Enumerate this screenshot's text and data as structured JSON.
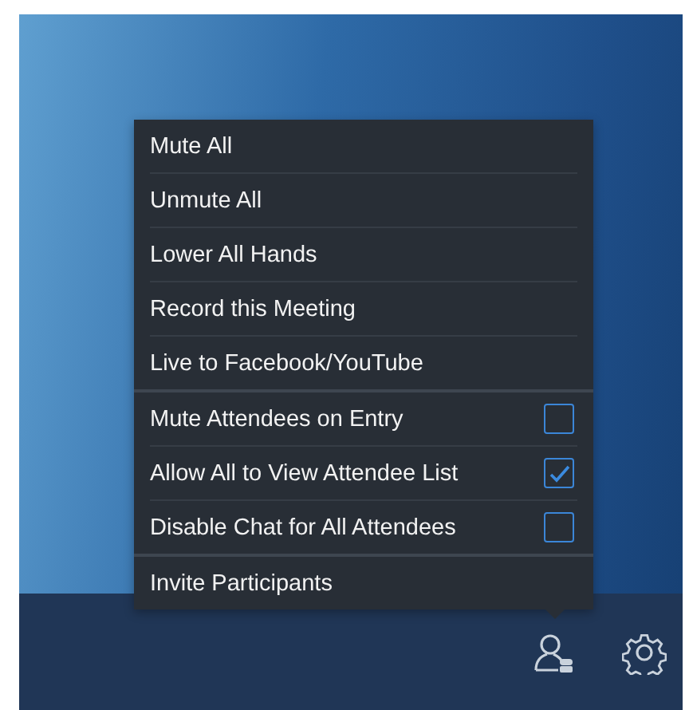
{
  "menu": {
    "groups": [
      {
        "items": [
          {
            "kind": "action",
            "label": "Mute All"
          },
          {
            "kind": "action",
            "label": "Unmute All"
          },
          {
            "kind": "action",
            "label": "Lower All Hands"
          },
          {
            "kind": "action",
            "label": "Record this Meeting"
          },
          {
            "kind": "action",
            "label": "Live to Facebook/YouTube"
          }
        ]
      },
      {
        "items": [
          {
            "kind": "toggle",
            "label": "Mute Attendees on Entry",
            "checked": false
          },
          {
            "kind": "toggle",
            "label": "Allow All to View Attendee List",
            "checked": true
          },
          {
            "kind": "toggle",
            "label": "Disable Chat for All Attendees",
            "checked": false
          }
        ]
      },
      {
        "items": [
          {
            "kind": "action",
            "label": "Invite Participants"
          }
        ]
      }
    ]
  }
}
